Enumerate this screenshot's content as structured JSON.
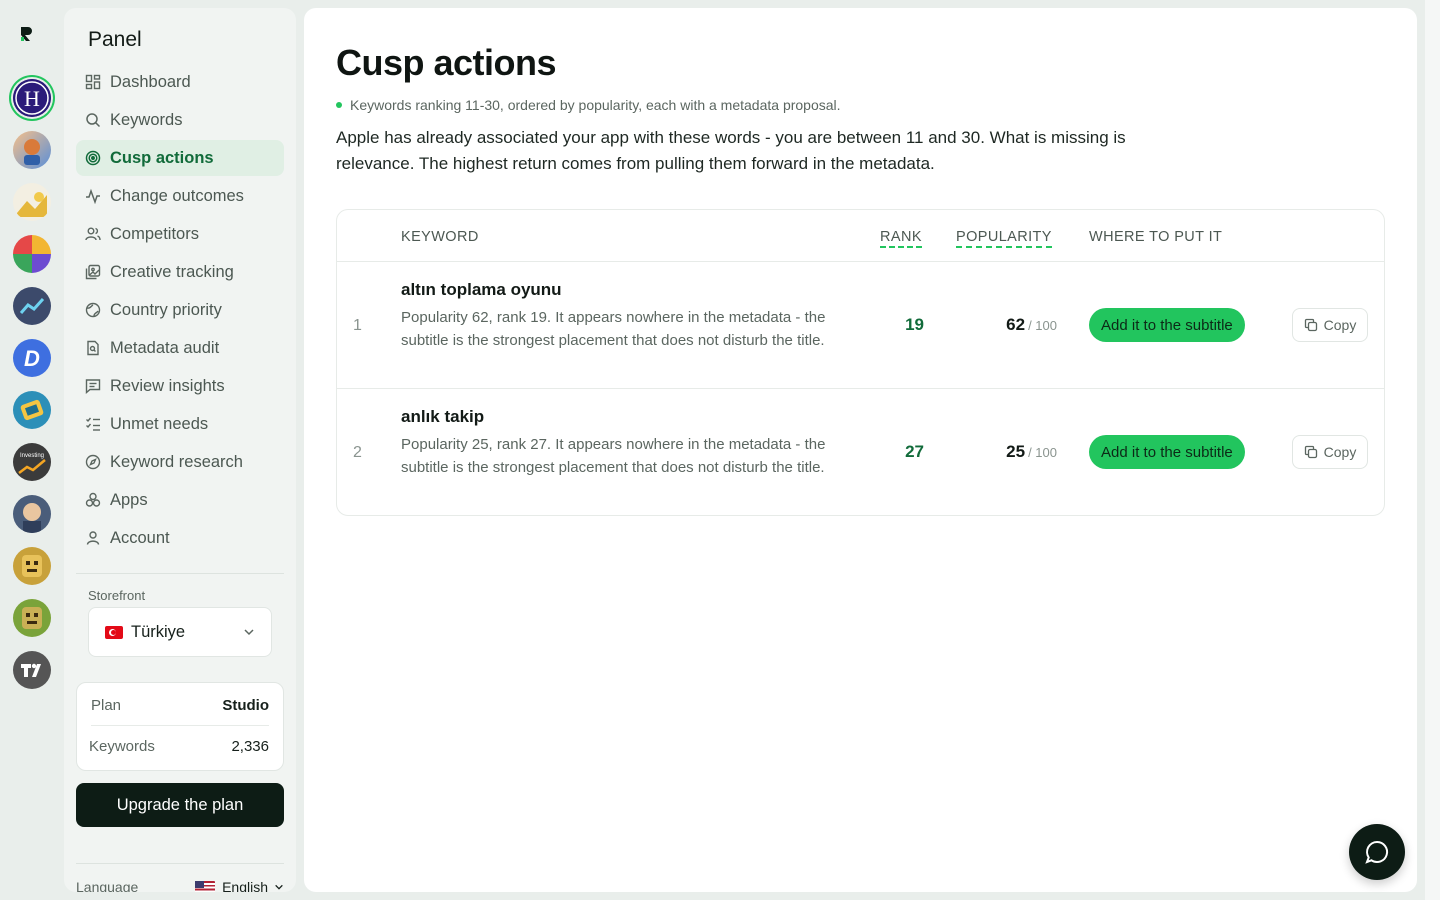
{
  "rail": {
    "apps": [
      {
        "name": "app-h",
        "letter": "H"
      },
      {
        "name": "app-2"
      },
      {
        "name": "app-3"
      },
      {
        "name": "app-4"
      },
      {
        "name": "app-5"
      },
      {
        "name": "app-6",
        "letter": "D"
      },
      {
        "name": "app-7"
      },
      {
        "name": "app-8",
        "label": "Investing"
      },
      {
        "name": "app-9"
      },
      {
        "name": "app-10"
      },
      {
        "name": "app-11"
      },
      {
        "name": "app-12",
        "letter": "TV"
      }
    ]
  },
  "sidebar": {
    "brand": "Panel",
    "items": [
      {
        "label": "Dashboard",
        "icon": "dashboard-icon"
      },
      {
        "label": "Keywords",
        "icon": "search-icon"
      },
      {
        "label": "Cusp actions",
        "icon": "target-icon",
        "active": true
      },
      {
        "label": "Change outcomes",
        "icon": "activity-icon"
      },
      {
        "label": "Competitors",
        "icon": "users-icon"
      },
      {
        "label": "Creative tracking",
        "icon": "images-icon"
      },
      {
        "label": "Country priority",
        "icon": "globe-icon"
      },
      {
        "label": "Metadata audit",
        "icon": "file-search-icon"
      },
      {
        "label": "Review insights",
        "icon": "message-icon"
      },
      {
        "label": "Unmet needs",
        "icon": "list-check-icon"
      },
      {
        "label": "Keyword research",
        "icon": "compass-icon"
      },
      {
        "label": "Apps",
        "icon": "apps-icon"
      },
      {
        "label": "Account",
        "icon": "user-icon"
      }
    ],
    "storefront_label": "Storefront",
    "storefront_value": "Türkiye",
    "plan_label": "Plan",
    "plan_value": "Studio",
    "keywords_label": "Keywords",
    "keywords_value": "2,336",
    "upgrade_label": "Upgrade the plan",
    "language_label": "Language",
    "language_value": "English"
  },
  "main": {
    "title": "Cusp actions",
    "subtitle": "Keywords ranking 11-30, ordered by popularity, each with a metadata proposal.",
    "description": "Apple has already associated your app with these words - you are between 11 and 30. What is missing is relevance. The highest return comes from pulling them forward in the metadata.",
    "table": {
      "headers": {
        "keyword": "KEYWORD",
        "rank": "RANK",
        "popularity": "POPULARITY",
        "where": "WHERE TO PUT IT"
      },
      "rows": [
        {
          "index": "1",
          "keyword": "altın toplama oyunu",
          "detail": "Popularity 62, rank 19. It appears nowhere in the metadata - the subtitle is the strongest placement that does not disturb the title.",
          "rank": "19",
          "popularity": "62",
          "popularity_max": "/ 100",
          "action": "Add it to the subtitle",
          "copy": "Copy"
        },
        {
          "index": "2",
          "keyword": "anlık takip",
          "detail": "Popularity 25, rank 27. It appears nowhere in the metadata - the subtitle is the strongest placement that does not disturb the title.",
          "rank": "27",
          "popularity": "25",
          "popularity_max": "/ 100",
          "action": "Add it to the subtitle",
          "copy": "Copy"
        }
      ]
    }
  },
  "colors": {
    "accent": "#22c55e",
    "accent_text": "#116b3a",
    "dark": "#0d1c15"
  }
}
